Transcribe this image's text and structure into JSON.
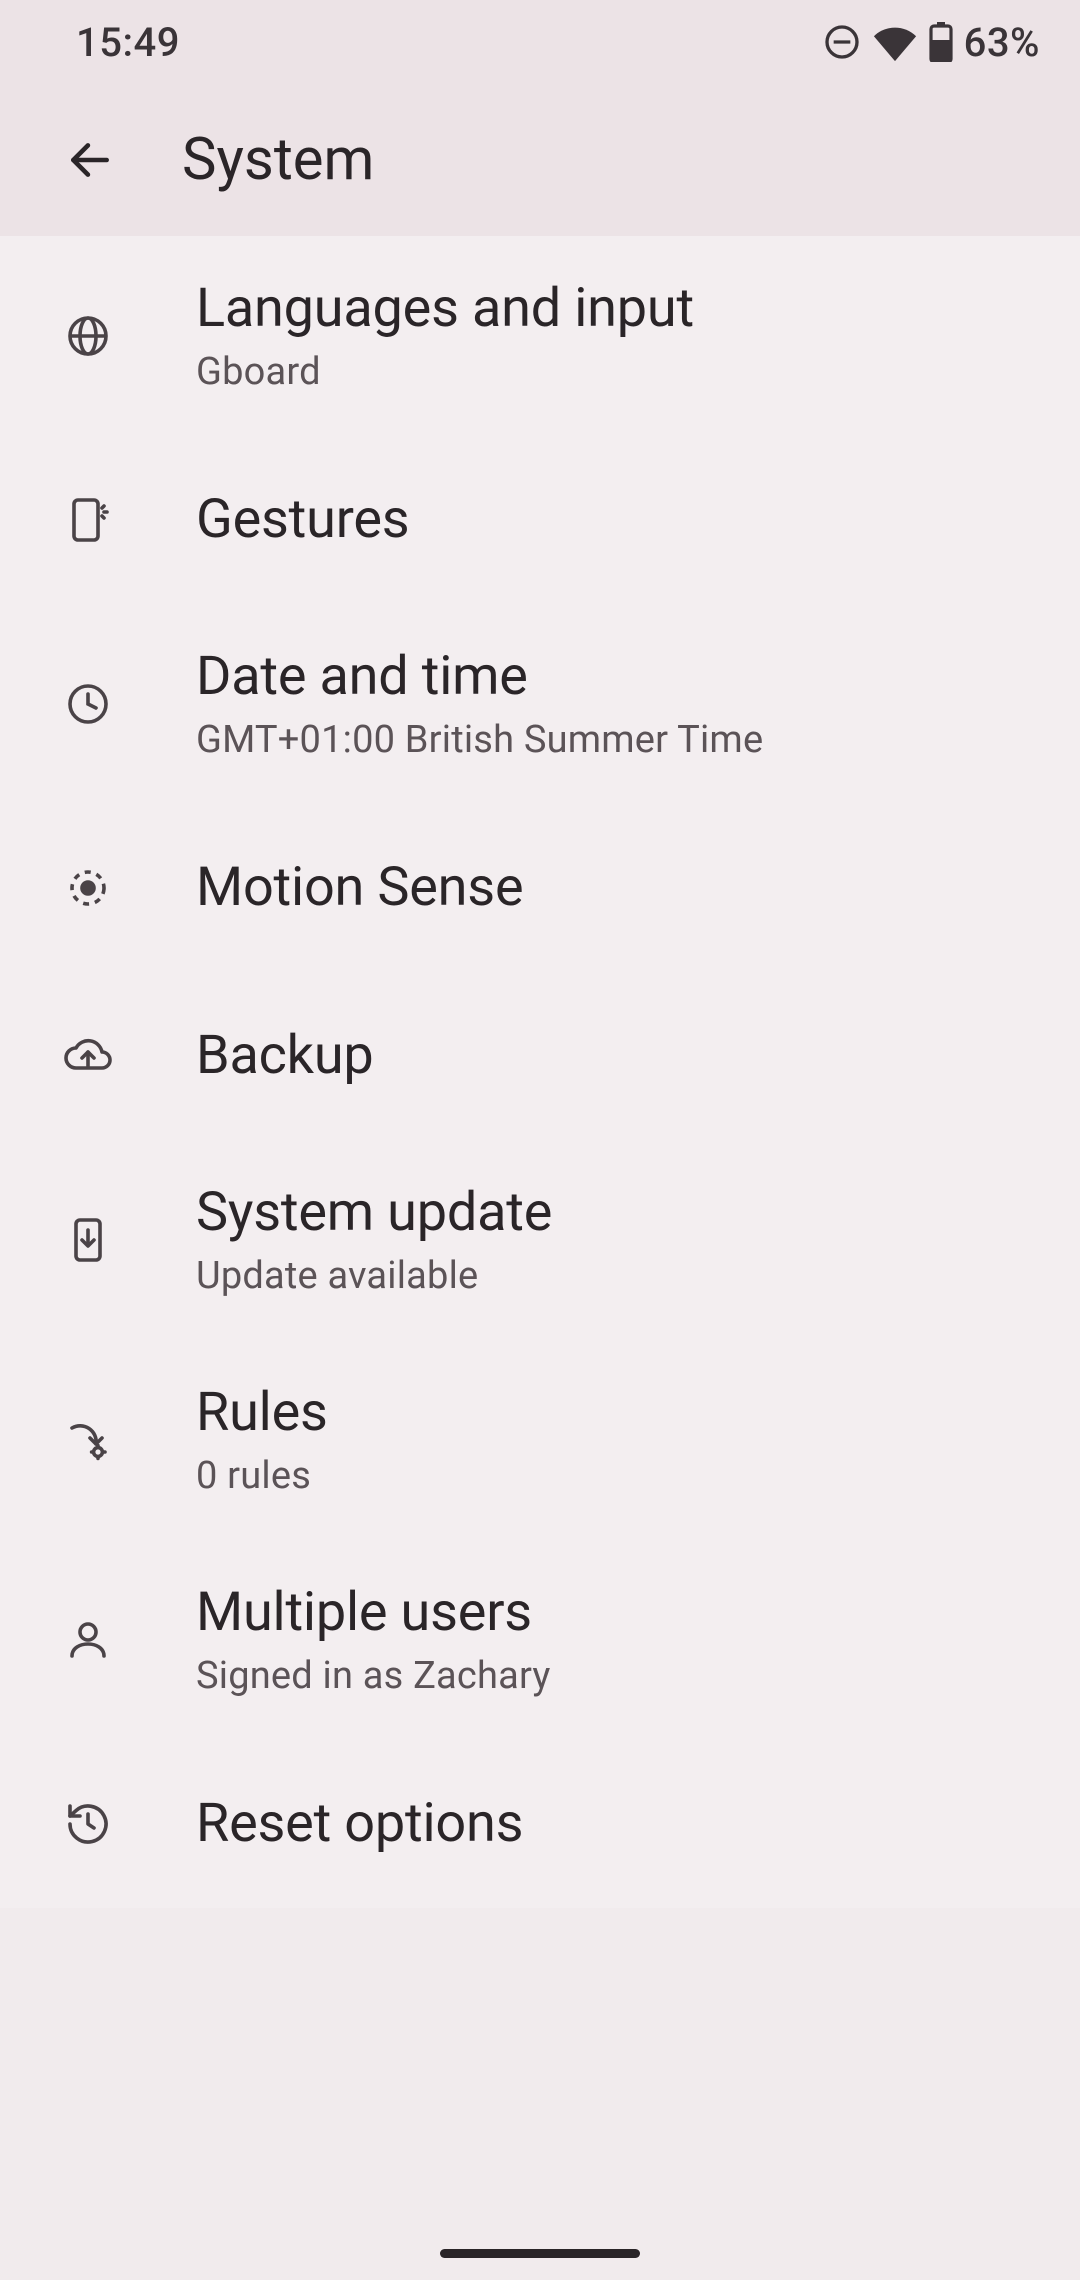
{
  "statusbar": {
    "time": "15:49",
    "battery_pct": "63%"
  },
  "header": {
    "title": "System"
  },
  "items": [
    {
      "icon": "globe-icon",
      "title": "Languages and input",
      "subtitle": "Gboard"
    },
    {
      "icon": "phone-sparkle-icon",
      "title": "Gestures",
      "subtitle": null
    },
    {
      "icon": "clock-icon",
      "title": "Date and time",
      "subtitle": "GMT+01:00 British Summer Time"
    },
    {
      "icon": "motion-sense-icon",
      "title": "Motion Sense",
      "subtitle": null
    },
    {
      "icon": "cloud-upload-icon",
      "title": "Backup",
      "subtitle": null
    },
    {
      "icon": "phone-download-icon",
      "title": "System update",
      "subtitle": "Update available"
    },
    {
      "icon": "rules-icon",
      "title": "Rules",
      "subtitle": "0 rules"
    },
    {
      "icon": "person-icon",
      "title": "Multiple users",
      "subtitle": "Signed in as Zachary"
    },
    {
      "icon": "history-icon",
      "title": "Reset options",
      "subtitle": null
    }
  ]
}
